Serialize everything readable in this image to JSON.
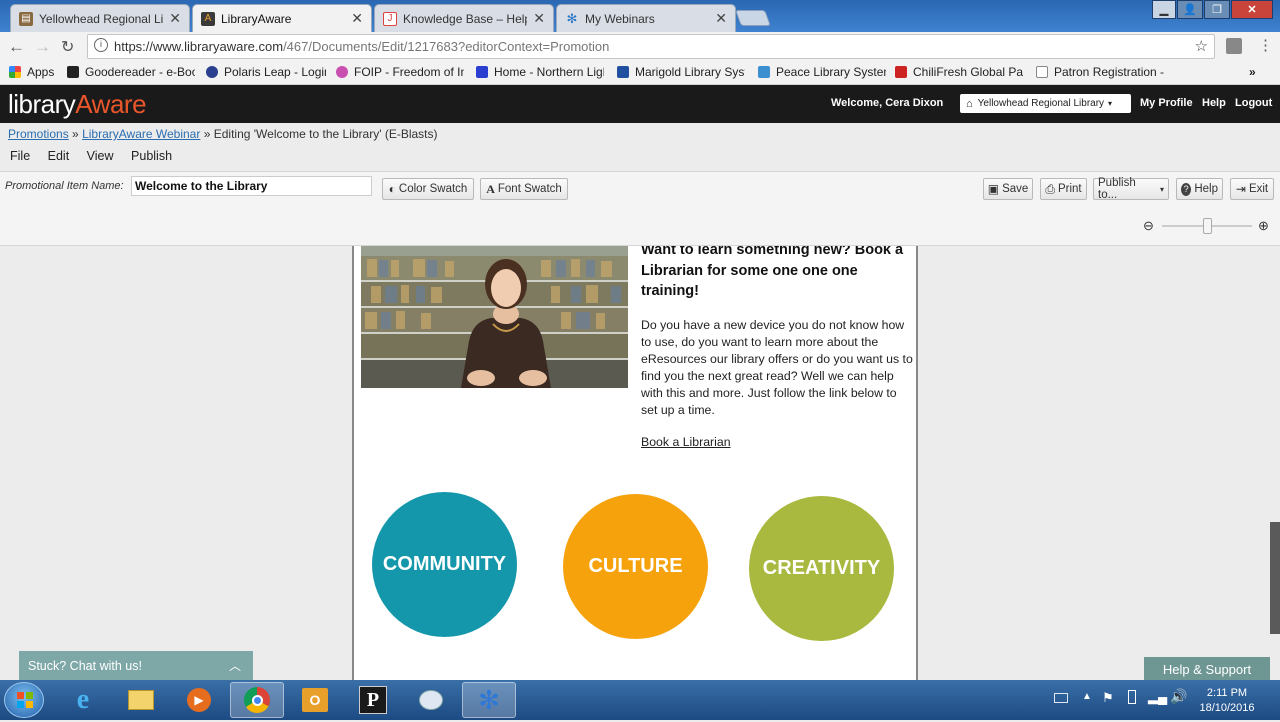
{
  "browser": {
    "tabs": [
      {
        "title": "Yellowhead Regional Lib",
        "icon": "book-icon",
        "active": false
      },
      {
        "title": "LibraryAware",
        "icon": "libraryaware-icon",
        "active": true
      },
      {
        "title": "Knowledge Base – Help",
        "icon": "knowledge-base-icon",
        "active": false
      },
      {
        "title": "My Webinars",
        "icon": "webinar-icon",
        "active": false
      }
    ],
    "url_host": "https://www.libraryaware.com",
    "url_path": "/467/Documents/Edit/1217683?editorContext=Promotion",
    "bookmarks": [
      "Apps",
      "Goodereader - e-Boo",
      "Polaris Leap - Login",
      "FOIP - Freedom of Inf",
      "Home - Northern Ligh",
      "Marigold Library Syste",
      "Peace Library System",
      "ChiliFresh Global Patr",
      "Patron Registration -"
    ],
    "bookmarks_more": "»"
  },
  "app": {
    "logo_left": "library",
    "logo_right": "Aware",
    "welcome": "Welcome, Cera  Dixon",
    "library_select": "Yellowhead Regional Library",
    "my_profile": "My Profile",
    "help": "Help",
    "logout": "Logout"
  },
  "breadcrumb": {
    "promotions": "Promotions",
    "sep1": "»",
    "webinar": "LibraryAware Webinar",
    "sep2": "»",
    "editing": "Editing 'Welcome to the Library' (E-Blasts)"
  },
  "menu": [
    "File",
    "Edit",
    "View",
    "Publish"
  ],
  "toolbar": {
    "name_label": "Promotional Item Name:",
    "name_value": "Welcome to the Library",
    "color_swatch": "Color Swatch",
    "font_swatch": "Font Swatch",
    "save": "Save",
    "print": "Print",
    "publish_to": "Publish to...",
    "help": "Help",
    "exit": "Exit",
    "zoom_level": 0.5
  },
  "document": {
    "headline": "Want to learn something new?  Book a Librarian for some one one one training!",
    "body": "Do you have a new device you do not know how to use, do you want to learn more about the eResources our library offers or do you want us to find you the next great read? Well we can help with this and more.  Just follow the link below to set up a time.",
    "link": "Book a Librarian",
    "circles": [
      {
        "label": "COMMUNITY",
        "color": "#1497ab"
      },
      {
        "label": "CULTURE",
        "color": "#f6a20d"
      },
      {
        "label": "CREATIVITY",
        "color": "#a9b83e"
      }
    ]
  },
  "chat": {
    "label": "Stuck? Chat with us!"
  },
  "help_support": "Help & Support",
  "taskbar": {
    "time": "2:11 PM",
    "date": "18/10/2016"
  }
}
